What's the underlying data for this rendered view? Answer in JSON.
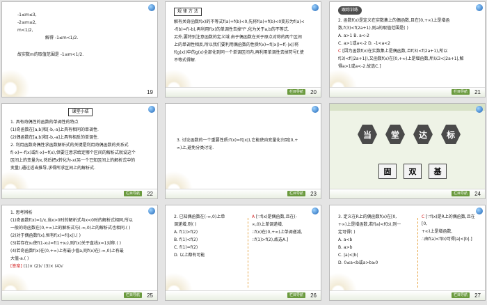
{
  "slides": [
    {
      "number": "19",
      "lines": [
        "-1≤m≤3,",
        "-2≤m≤2,",
        "m<1/2,",
        "解得 -1≤m<1/2.",
        "故实数m的取值范围是 -1≤m<1/2."
      ]
    },
    {
      "number": "20",
      "tag": "规 律 方 法",
      "lines": [
        "解有关奇函数f(x)的不等式f(a)+f(b)<0,先将f(a)+f(b)<0变形为f(a)<",
        "-f(b)=f(-b),再利用f(x)的单调性去掉\"f\",化为关于a,b的不等式.",
        "另外,要特别注意函数的定义域.由于偶函数在关于原点对称的两个区间",
        "上的单调性相反,所以我们要利用偶函数的性质f(x)=f(|x|)=f(-|x|)将",
        "f(g(x))中的g(x)全部化到同一个单调区间内,再利用单调性去掉符号f,使",
        "不等式得解."
      ],
      "footer": "栏目导航"
    },
    {
      "number": "21",
      "tag": "跟踪训练",
      "lines": [
        "2. 函数f(x)是定义在实数集上的偶函数,且在[0,+∞)上是增函",
        "数,f(3)<f(2a+1),则a的取值范围是(     )",
        "A. a>1          B. a<-2",
        "C. a>1或a<-2    D. -1<a<2"
      ],
      "answer_tag": "C",
      "answer_lines": [
        "[因为函数f(x)在实数集上是偶函数,且f(3)<f(2a+1),所以",
        "f(3)<f(|2a+1|),又函数f(x)在[0,+∞)上是增函数,所以3<|2a+1|,解",
        "得a>1或a<-2.故选C.]"
      ],
      "footer": "栏目导航"
    },
    {
      "number": "22",
      "tag": "课堂小结",
      "lines": [
        "1. 具有奇偶性的函数的单调性的特点",
        "(1)奇函数在[a,b]和[-b,-a]上具有相同的单调性.",
        "(2)偶函数在[a,b]和[-b,-a]上具有相反的单调性.",
        "2. 利用函数奇偶性求函数解析式的关键是利用奇偶函数的关系式",
        "f(-x)=-f(x)或f(-x)=f(x),但要注意求给定哪个区间的解析式就设这个",
        "区间上的变量为x,然后把x转化为-x(另一个已知区间上的解析式中的",
        "变量),通过适当推导,求得所求区间上的解析式."
      ],
      "footer": "栏目导航"
    },
    {
      "number": "23",
      "lines": [
        "3. 讨论函数的一个重要性质:f(x)=f(|x|),它能使自变量化归到[0,+",
        "∞)上,避免分类讨论."
      ],
      "footer": "栏目导航"
    },
    {
      "number": "24",
      "title_chars": [
        "当",
        "堂",
        "达",
        "标"
      ],
      "sub_chars": [
        "固",
        "双",
        "基"
      ],
      "footer": "栏目导航"
    },
    {
      "number": "25",
      "lines": [
        "1. 思考辨析",
        "(1)奇函数f(x)=1/x,当x>0时的解析式与x<0时的解析式相同,所以",
        "一般的奇函数在(0,+∞)上的解析式与(-∞,0)上的解析式也相同.(  )",
        "(2)对于偶函数f(x),恒有f(x)=f(|x|).(  )",
        "(3)若存在x₀使f(1-x₀)=f(1+x₀),则f(x)关于直线x=1对称.(  )",
        "(4)若奇函数f(x)在(0,+∞)上有最小值a,则f(x)在(-∞,0)上有最",
        "大值-a.(  )"
      ],
      "answer_tag": "[答案]",
      "answer_text": "(1)×  (2)√  (3)×  (4)√",
      "footer": "栏目导航"
    },
    {
      "number": "26",
      "lines": [
        "2. 已知偶函数在(-∞,0)上单",
        "调递增,则(     )",
        "A. f(1)>f(2)",
        "B. f(1)<f(2)",
        "C. f(1)=f(2)",
        "D. 以上都有可能"
      ],
      "answer_tag": "A",
      "answer_lines": [
        "[∵f(x)是偶函数,且在(-",
        "∞,0)上单调递增,",
        "∴f(x)在(0,+∞)上单调递减,",
        "∴f(1)>f(2),故选A.]"
      ],
      "footer": "栏目导航"
    },
    {
      "number": "27",
      "lines": [
        "3. 定义在R上的偶函数f(x)在[0,",
        "+∞)上是增函数,若f(a)<f(b),则一",
        "定可得(     )",
        "A. a<b",
        "B. a>b",
        "C. |a|<|b|",
        "D. 0≤a<b或a>b≥0"
      ],
      "answer_tag": "C",
      "answer_lines": [
        "[∵f(x)是R上的偶函数,且在[0,",
        "+∞)上是增函数,",
        "∴由f(a)<f(b)可得|a|<|b|.]"
      ],
      "footer": "栏目导航"
    }
  ]
}
